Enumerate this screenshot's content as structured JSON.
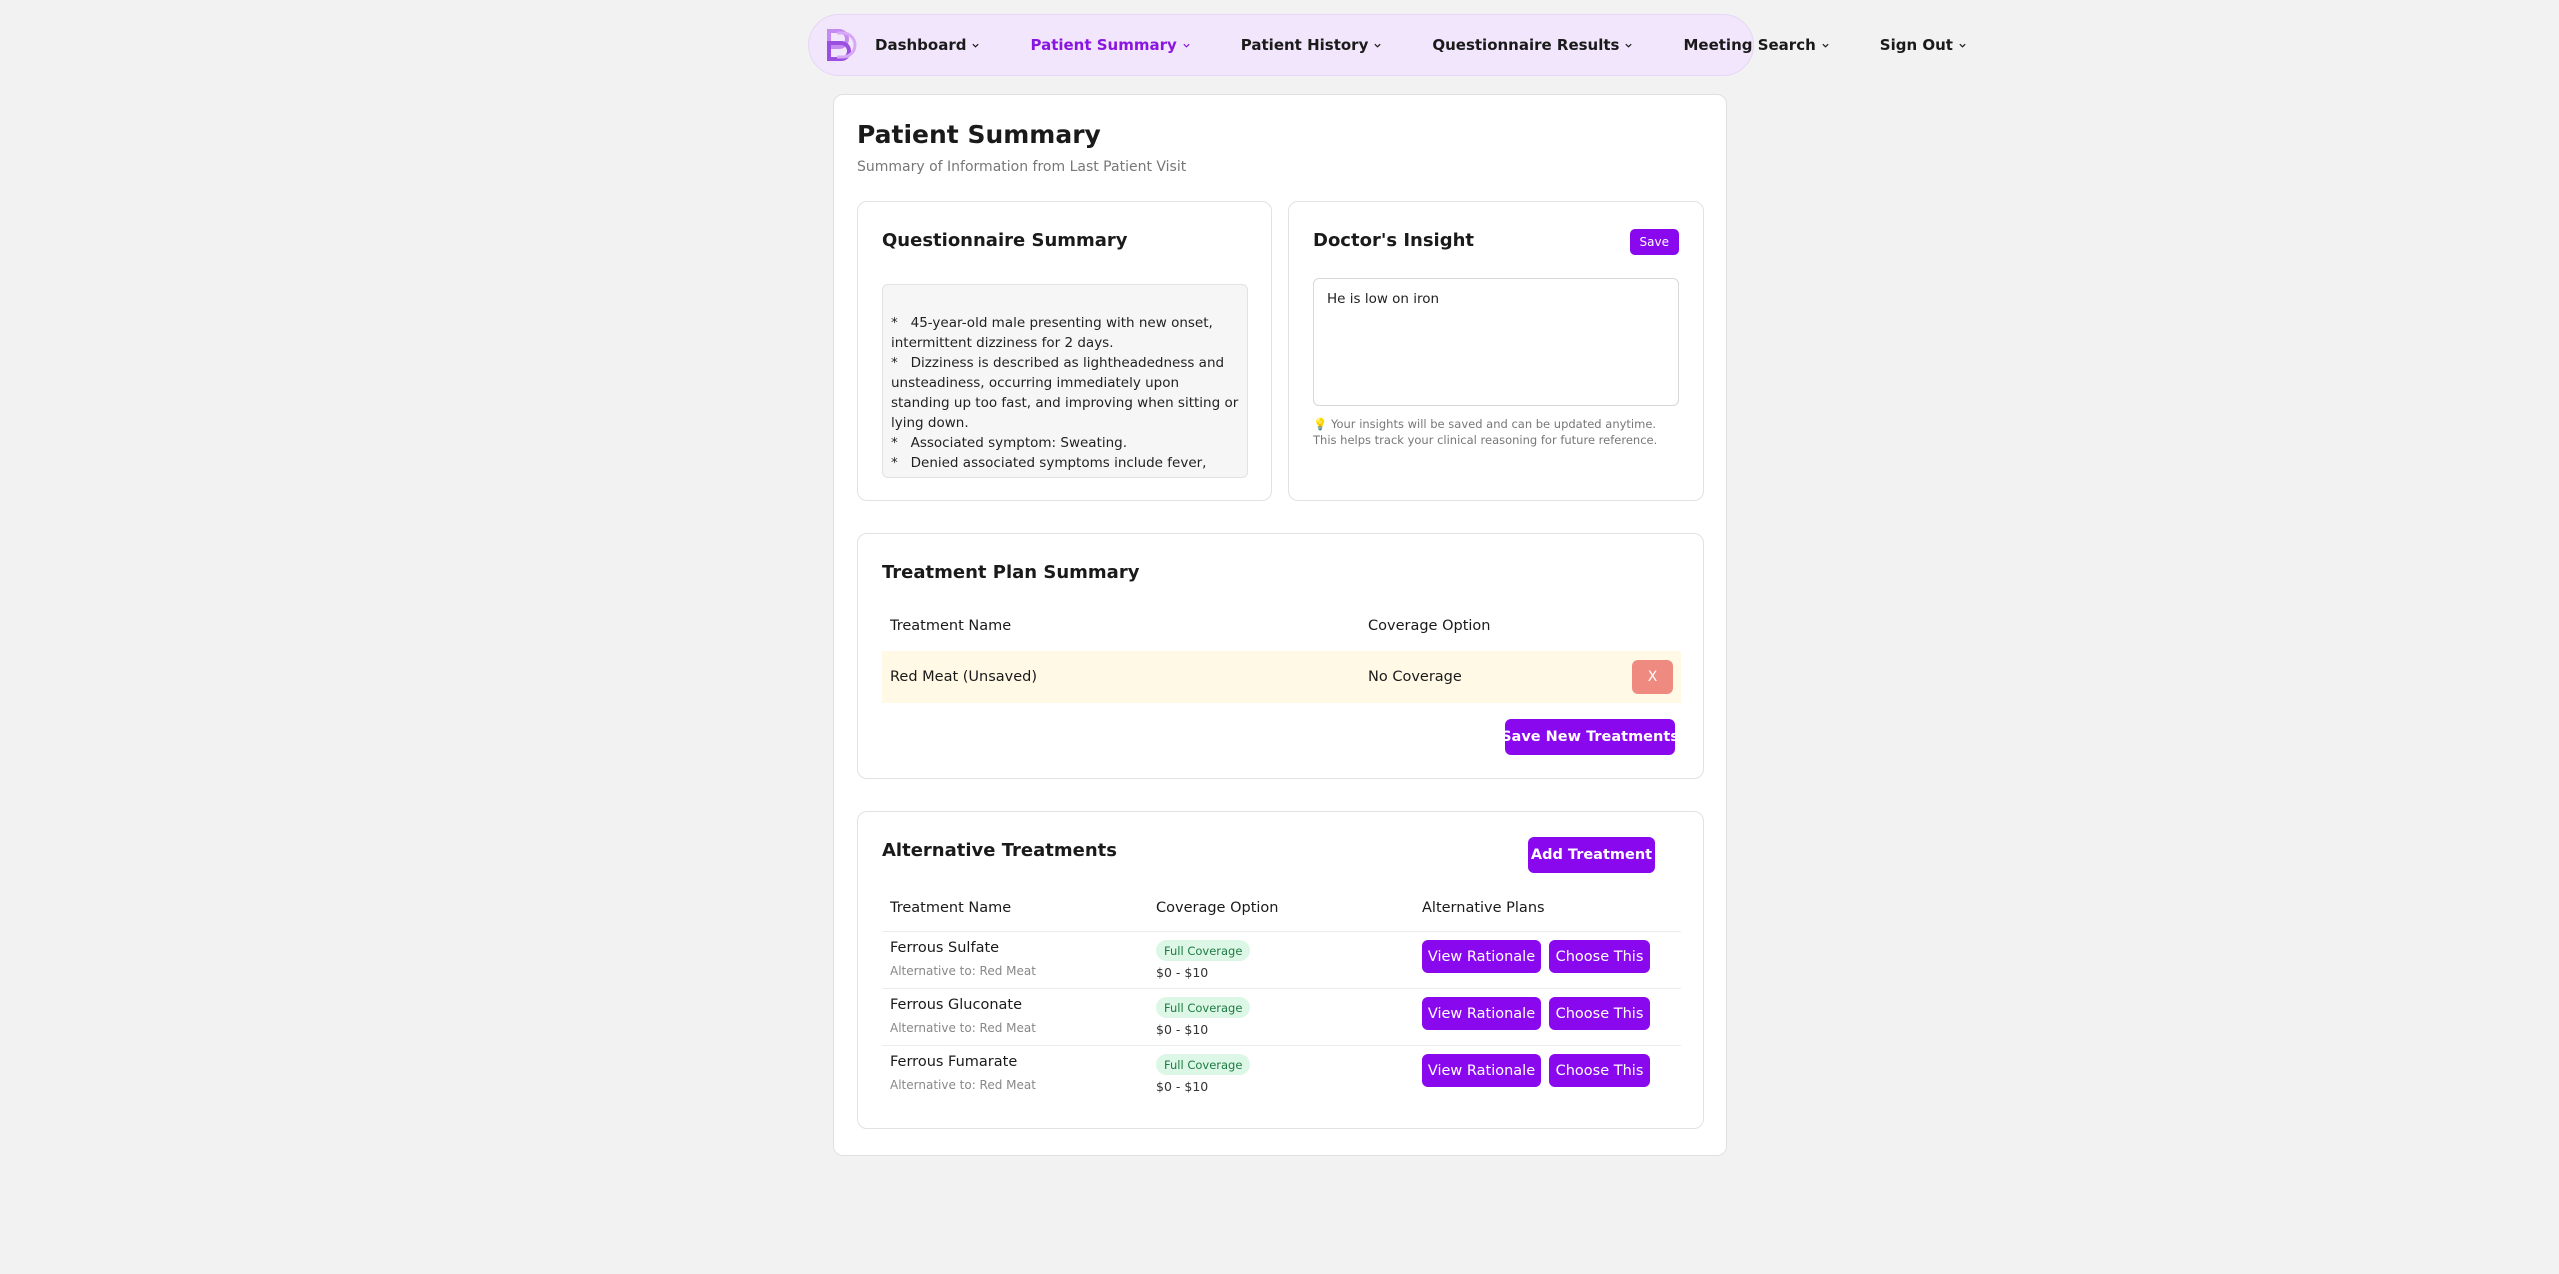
{
  "nav": {
    "items": [
      {
        "label": "Dashboard",
        "active": false
      },
      {
        "label": "Patient Summary",
        "active": true
      },
      {
        "label": "Patient History",
        "active": false
      },
      {
        "label": "Questionnaire Results",
        "active": false
      },
      {
        "label": "Meeting Search",
        "active": false
      },
      {
        "label": "Sign Out",
        "active": false
      }
    ]
  },
  "page": {
    "title": "Patient Summary",
    "subtitle": "Summary of Information from Last Patient Visit"
  },
  "questionnaire": {
    "title": "Questionnaire Summary",
    "lines": [
      "*   45-year-old male presenting with new onset, intermittent dizziness for 2 days.",
      "*   Dizziness is described as lightheadedness and unsteadiness, occurring immediately upon standing up too fast, and improving when sitting or lying down.",
      "*   Associated symptom: Sweating.",
      "*   Denied associated symptoms include fever, nausea, pain, blurred vision, ringing in ears, chest pain,"
    ]
  },
  "insight": {
    "title": "Doctor's Insight",
    "save_label": "Save",
    "text": "He is low on iron",
    "tip": "Your insights will be saved and can be updated anytime. This helps track your clinical reasoning for future reference.",
    "tip_icon": "lightbulb-icon"
  },
  "treatment_plan": {
    "title": "Treatment Plan Summary",
    "headers": [
      "Treatment Name",
      "Coverage Option"
    ],
    "rows": [
      {
        "name": "Red Meat (Unsaved)",
        "coverage": "No Coverage",
        "remove_label": "X"
      }
    ],
    "save_label": "Save New Treatments"
  },
  "alternatives": {
    "title": "Alternative Treatments",
    "add_label": "Add Treatment",
    "headers": [
      "Treatment Name",
      "Coverage Option",
      "Alternative Plans"
    ],
    "rows": [
      {
        "name": "Ferrous Sulfate",
        "alt": "Alternative to: Red Meat",
        "badge": "Full Coverage",
        "price": "$0 - $10",
        "view": "View Rationale",
        "choose": "Choose This"
      },
      {
        "name": "Ferrous Gluconate",
        "alt": "Alternative to: Red Meat",
        "badge": "Full Coverage",
        "price": "$0 - $10",
        "view": "View Rationale",
        "choose": "Choose This"
      },
      {
        "name": "Ferrous Fumarate",
        "alt": "Alternative to: Red Meat",
        "badge": "Full Coverage",
        "price": "$0 - $10",
        "view": "View Rationale",
        "choose": "Choose This"
      }
    ]
  },
  "colors": {
    "accent": "#8a08ee",
    "nav_bg": "#f1e6fb",
    "unsaved_row": "#fff9e6",
    "remove": "#ef8a80",
    "badge_bg": "#dcf7e6"
  }
}
